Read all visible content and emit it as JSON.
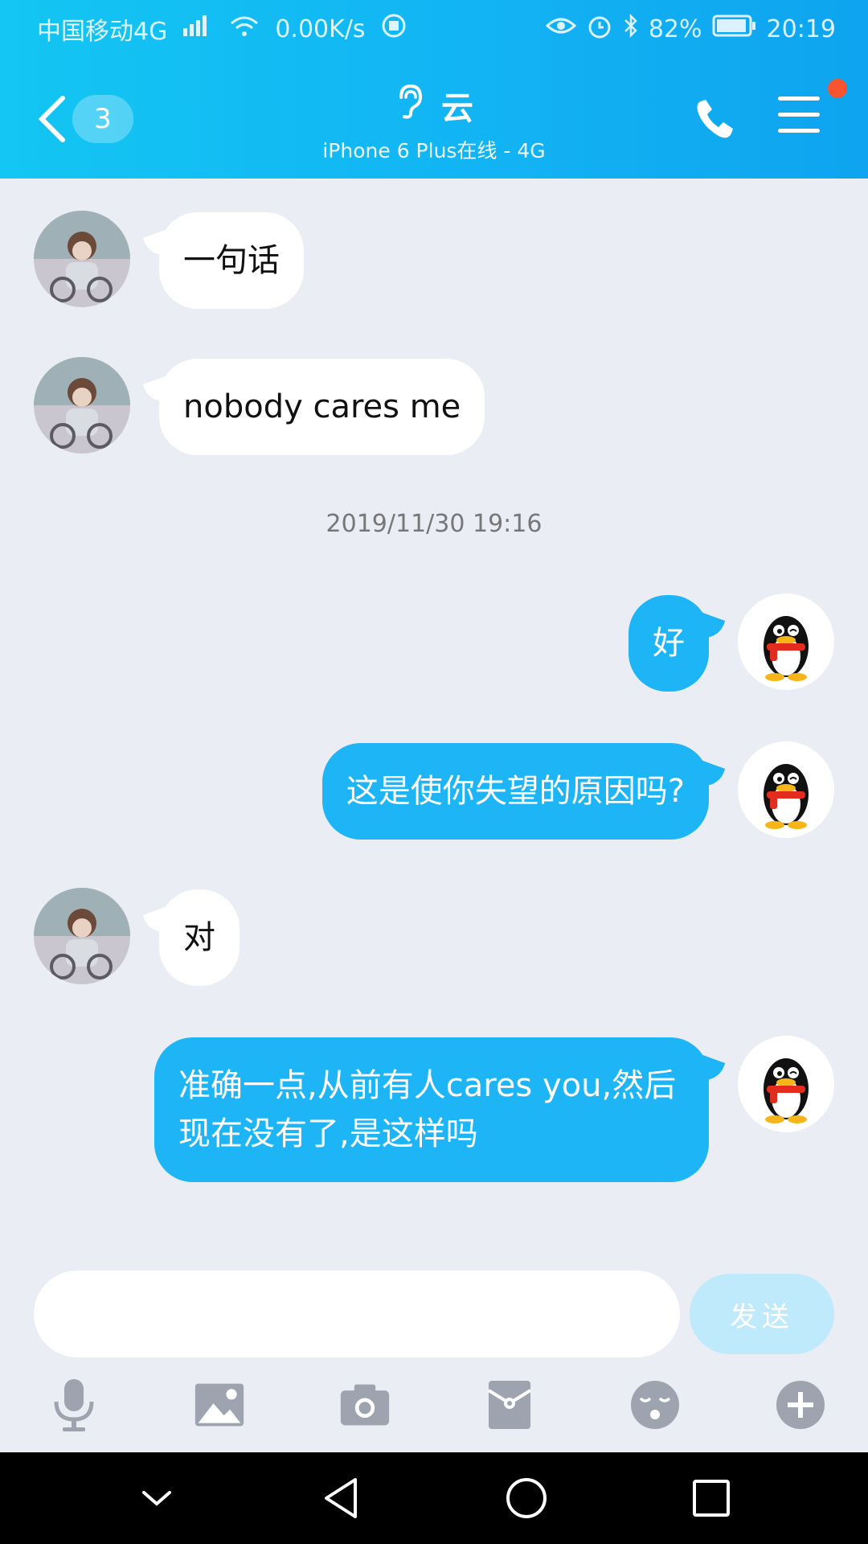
{
  "status_bar": {
    "carrier": "中国移动4G",
    "signal_tag": "4G",
    "speed": "0.00K/s",
    "battery": "82%",
    "time": "20:19"
  },
  "header": {
    "unread_count": "3",
    "contact_name": "云",
    "subtitle": "iPhone 6 Plus在线 - 4G"
  },
  "messages": [
    {
      "side": "in",
      "text": "一句话"
    },
    {
      "side": "in",
      "text": "nobody cares me"
    },
    {
      "side": "time",
      "text": "2019/11/30 19:16"
    },
    {
      "side": "out",
      "text": "好"
    },
    {
      "side": "out",
      "text": "这是使你失望的原因吗?"
    },
    {
      "side": "in",
      "text": "对"
    },
    {
      "side": "out",
      "text": "准确一点,从前有人cares you,然后现在没有了,是这样吗"
    }
  ],
  "input": {
    "placeholder": "",
    "send_label": "发送"
  },
  "toolbar": [
    "microphone-icon",
    "image-icon",
    "camera-icon",
    "red-packet-icon",
    "emoji-icon",
    "plus-icon"
  ],
  "colors": {
    "header_start": "#13c6f3",
    "header_end": "#0ea4ef",
    "outgoing_bubble": "#1eb5f6",
    "incoming_bubble": "#ffffff",
    "chat_background": "#eaedf4",
    "notification_dot": "#f9542f",
    "send_button": "#bfeafb",
    "toolbar_icon": "#9ea3b0"
  }
}
